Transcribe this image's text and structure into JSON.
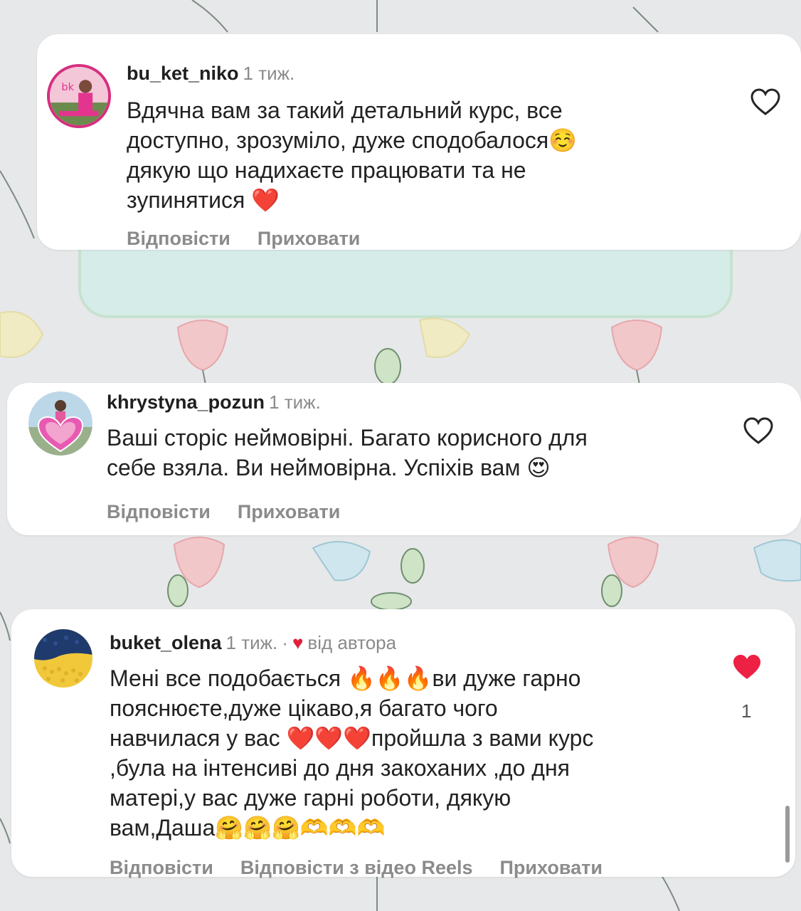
{
  "comments": [
    {
      "username": "bu_ket_niko",
      "time": "1 тиж.",
      "lines": [
        "Вдячна вам за такий детальний курс, все",
        "доступно, зрозуміло, дуже сподобалося☺️",
        "дякую що надихаєте працювати та не",
        "зупинятися ❤️"
      ],
      "reply": "Відповісти",
      "hide": "Приховати",
      "liked": false
    },
    {
      "username": "khrystyna_pozun",
      "time": "1 тиж.",
      "lines": [
        "Ваші сторіс неймовірні. Багато корисного для",
        "себе взяла. Ви неймовірна. Успіхів вам 😍"
      ],
      "reply": "Відповісти",
      "hide": "Приховати",
      "liked": false
    },
    {
      "username": "buket_olena",
      "time": "1 тиж.",
      "separator": "·",
      "author_badge": "від автора",
      "lines": [
        "Мені все подобається 🔥🔥🔥ви дуже гарно",
        "пояснюєте,дуже цікаво,я багато чого",
        "навчилася у вас ❤️❤️❤️пройшла з вами курс",
        ",була на інтенсиві до дня закоханих ,до дня",
        "матері,у вас дуже гарні роботи, дякую",
        "вам,Даша🤗🤗🤗🫶🫶🫶"
      ],
      "reply": "Відповісти",
      "reply_reels": "Відповісти з відео Reels",
      "hide": "Приховати",
      "liked": true,
      "like_count": "1"
    }
  ],
  "colors": {
    "like_active": "#ed2144",
    "muted_text": "#8b8b8b",
    "card_bg": "#ffffff",
    "background": "#e7e8ea"
  }
}
